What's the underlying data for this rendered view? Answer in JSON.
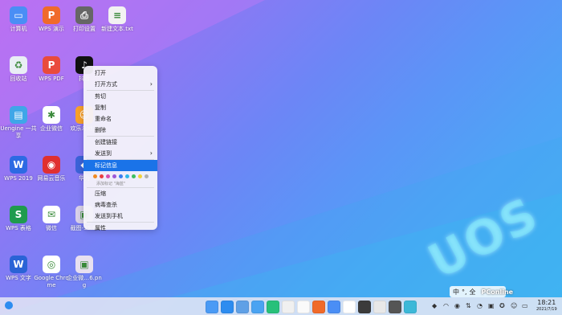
{
  "desktop": {
    "icons": [
      {
        "label": "计算机",
        "icon": "computer-icon",
        "color": "#4a8ef5",
        "glyph": "▭"
      },
      {
        "label": "WPS 演示",
        "icon": "wps-presentation-icon",
        "color": "#f06a2a",
        "glyph": "P"
      },
      {
        "label": "打印设置",
        "icon": "printer-icon",
        "color": "#666666",
        "glyph": "⎙"
      },
      {
        "label": "新建文本.txt",
        "icon": "text-file-icon",
        "color": "#f2f2f2",
        "glyph": "≡"
      },
      {
        "label": "回收站",
        "icon": "trash-icon",
        "color": "#e9eef5",
        "glyph": "♻"
      },
      {
        "label": "WPS PDF",
        "icon": "wps-pdf-icon",
        "color": "#e94b3c",
        "glyph": "P"
      },
      {
        "label": "抖音",
        "icon": "douyin-icon",
        "color": "#111111",
        "glyph": "♪"
      },
      {
        "label": "Uengine 一共享",
        "icon": "folder-icon",
        "color": "#3fa6e8",
        "glyph": "▤"
      },
      {
        "label": "企业微信",
        "icon": "wecom-icon",
        "color": "#ffffff",
        "glyph": "✱"
      },
      {
        "label": "欢乐斗地主",
        "icon": "game-icon",
        "color": "#f8a02a",
        "glyph": "☺"
      },
      {
        "label": "WPS 2019",
        "icon": "wps-2019-icon",
        "color": "#2d6ae3",
        "glyph": "W"
      },
      {
        "label": "网易云音乐",
        "icon": "netease-music-icon",
        "color": "#e03030",
        "glyph": "◉"
      },
      {
        "label": "华为",
        "icon": "app-icon",
        "color": "#3b62d8",
        "glyph": "◆"
      },
      {
        "label": "WPS 表格",
        "icon": "wps-spreadsheet-icon",
        "color": "#1f9b4e",
        "glyph": "S"
      },
      {
        "label": "微信",
        "icon": "wechat-icon",
        "color": "#ffffff",
        "glyph": "✉"
      },
      {
        "label": "截图-35.tif",
        "icon": "image-file-icon",
        "color": "#d8d0e8",
        "glyph": "▣"
      },
      {
        "label": "WPS 文字",
        "icon": "wps-writer-icon",
        "color": "#2a63d6",
        "glyph": "W"
      },
      {
        "label": "Google Chrome",
        "icon": "chrome-icon",
        "color": "#ffffff",
        "glyph": "◎"
      },
      {
        "label": "企业微…6.png",
        "icon": "image-file-icon",
        "color": "#e8e0f0",
        "glyph": "▣"
      }
    ]
  },
  "context_menu": {
    "items": [
      {
        "label": "打开",
        "submenu": false
      },
      {
        "label": "打开方式",
        "submenu": true
      },
      {
        "label": "剪切",
        "submenu": false
      },
      {
        "label": "复制",
        "submenu": false
      },
      {
        "label": "重命名",
        "submenu": false
      },
      {
        "label": "删除",
        "submenu": false
      },
      {
        "label": "创建链接",
        "submenu": false
      },
      {
        "label": "发送到",
        "submenu": true
      },
      {
        "label": "标记信息",
        "submenu": false,
        "selected": true
      },
      {
        "label": "压缩",
        "submenu": false
      },
      {
        "label": "病毒查杀",
        "submenu": false
      },
      {
        "label": "发送到手机",
        "submenu": false
      },
      {
        "label": "属性",
        "submenu": false
      }
    ],
    "tag_colors": [
      "#f08a24",
      "#e84040",
      "#d84fb0",
      "#9b59d8",
      "#3a7ef0",
      "#2fb7e8",
      "#3cc060",
      "#f2d23a",
      "#b0b0b0"
    ],
    "tag_hint": "添加标记 \"海蓝\""
  },
  "ime": {
    "lang": "中",
    "punct": "°,",
    "full": "全"
  },
  "watermark": {
    "brand": "UOS",
    "site": "PConline"
  },
  "clock": {
    "time": "18:21",
    "date": "2021/7/19"
  },
  "dock": {
    "apps": [
      {
        "icon": "launcher-icon",
        "color": "#4a9af5"
      },
      {
        "icon": "browser-icon",
        "color": "#2d8cf0"
      },
      {
        "icon": "files-icon",
        "color": "#5fa0e6"
      },
      {
        "icon": "gallery-icon",
        "color": "#4aa3f2"
      },
      {
        "icon": "music-icon",
        "color": "#28c07a"
      },
      {
        "icon": "video-icon",
        "color": "#f0f0f0"
      },
      {
        "icon": "calendar-icon",
        "color": "#fafafa"
      },
      {
        "icon": "store-icon",
        "color": "#f06a2a"
      },
      {
        "icon": "settings-icon",
        "color": "#4a8ef5"
      },
      {
        "icon": "chrome-icon",
        "color": "#ffffff"
      },
      {
        "icon": "terminal-icon",
        "color": "#3b3b3b"
      },
      {
        "icon": "printer-icon",
        "color": "#e8e8e8"
      },
      {
        "icon": "camera-icon",
        "color": "#555555"
      },
      {
        "icon": "screenshot-icon",
        "color": "#3cb8d8"
      }
    ],
    "tray": [
      "android-icon",
      "wifi-icon",
      "volume-icon",
      "network-icon",
      "bell-icon",
      "notification-icon",
      "security-icon",
      "user-icon",
      "battery-icon"
    ]
  }
}
